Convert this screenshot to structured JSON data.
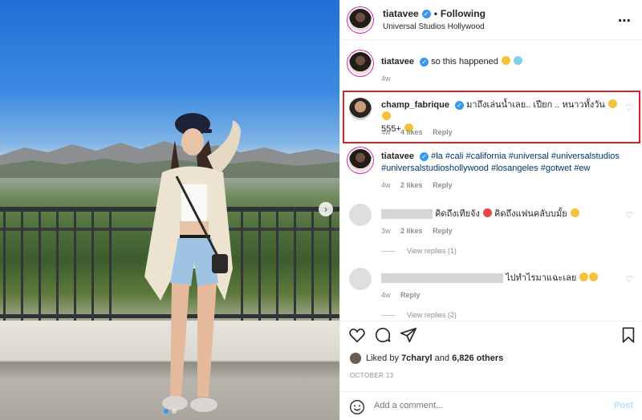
{
  "header": {
    "username": "tiatavee",
    "follow_status": "Following",
    "separator": "•",
    "location": "Universal Studios Hollywood",
    "more_icon": "⋯"
  },
  "caption": {
    "username": "tiatavee",
    "text": "so this happened",
    "time": "4w"
  },
  "comments": [
    {
      "username": "champ_fabrique",
      "text_line1": "มาถึงเล่นน้ำเลย.. เปียก .. หนาวทั้งวัน",
      "text_line2": "555+",
      "time": "4w",
      "likes": "4 likes",
      "reply": "Reply"
    },
    {
      "username": "tiatavee",
      "tags_line1": "#la #cali #california #universal #universalstudios",
      "tags_line2": "#universalstudioshollywood #losangeles #gotwet #ew",
      "time": "4w",
      "likes": "2 likes",
      "reply": "Reply"
    },
    {
      "text": "คิดถึงเทียจัง",
      "text2": "คิดถึงแฟนคลับบมั้ย",
      "time": "3w",
      "likes": "2 likes",
      "reply": "Reply",
      "view_replies": "View replies (1)"
    },
    {
      "text": "ไปทำไรมาแฉะเลย",
      "time": "4w",
      "reply": "Reply",
      "view_replies": "View replies (2)"
    }
  ],
  "likes": {
    "prefix": "Liked by",
    "user": "7charyl",
    "and": "and",
    "others": "6,826 others"
  },
  "date": "OCTOBER 13",
  "add_comment": {
    "placeholder": "Add a comment...",
    "post": "Post"
  },
  "icons": [
    "heart-icon",
    "comment-icon",
    "share-icon",
    "bookmark-icon",
    "smiley-icon",
    "carousel-next-icon",
    "verified-icon"
  ],
  "colors": {
    "link": "#00376b",
    "verified": "#3897f0",
    "highlight": "#d8222a",
    "post_disabled": "#b2dffc"
  }
}
